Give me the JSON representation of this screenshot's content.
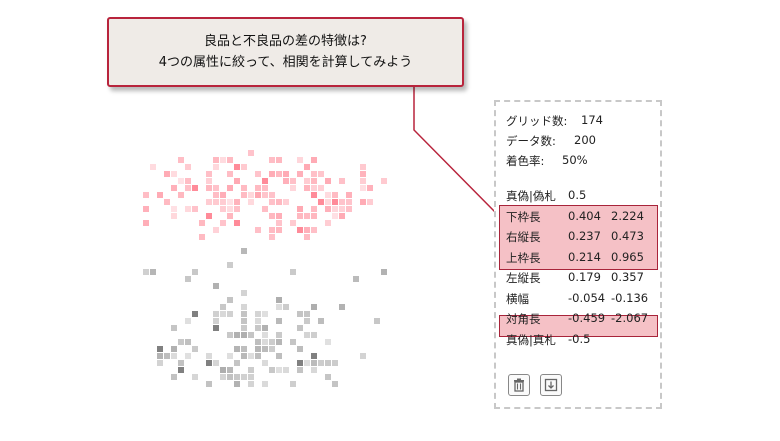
{
  "callout": {
    "line1": "良品と不良品の差の特徴は?",
    "line2": "4つの属性に絞って、相関を計算してみよう"
  },
  "stats": {
    "grids_label": "グリッド数:",
    "grids_value": "174",
    "data_label": "データ数:",
    "data_value": "200",
    "color_label": "着色率:",
    "color_value": "50%"
  },
  "features": [
    {
      "label": "真偽|偽札",
      "v1": "0.5",
      "v2": ""
    },
    {
      "label": "下枠長",
      "v1": "0.404",
      "v2": "2.224"
    },
    {
      "label": "右縦長",
      "v1": "0.237",
      "v2": "0.473"
    },
    {
      "label": "上枠長",
      "v1": "0.214",
      "v2": "0.965"
    },
    {
      "label": "左縦長",
      "v1": "0.179",
      "v2": "0.357"
    },
    {
      "label": "横幅",
      "v1": "-0.054",
      "v2": "-0.136"
    },
    {
      "label": "対角長",
      "v1": "-0.459",
      "v2": "-2.067"
    },
    {
      "label": "真偽|真札",
      "v1": "-0.5",
      "v2": ""
    }
  ],
  "buttons": {
    "delete_icon": "trash-icon",
    "export_icon": "download-icon"
  },
  "colors": {
    "accent": "#b8243c",
    "highlight": "#f5c1c6",
    "good_cells": "#ff5a6e",
    "bad_cells": "#555555"
  }
}
